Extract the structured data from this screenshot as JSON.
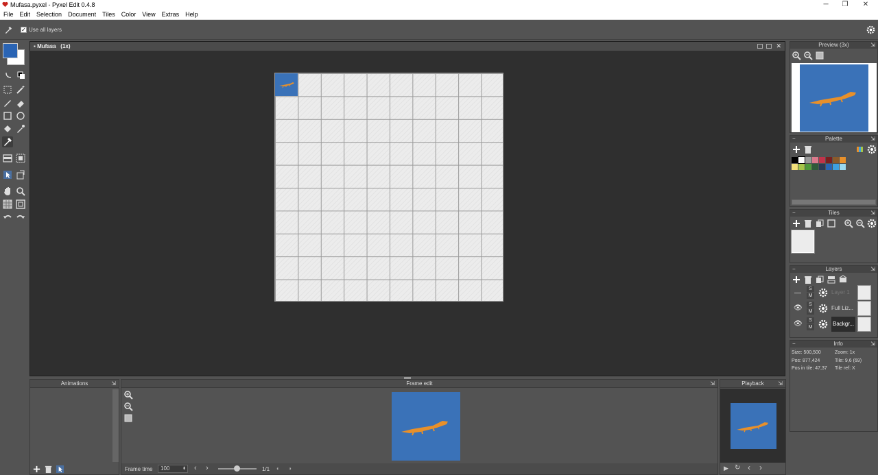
{
  "window": {
    "title": "Mufasa.pyxel - Pyxel Edit 0.4.8",
    "minimize": "─",
    "maximize": "❐",
    "close": "✕"
  },
  "menu": [
    "File",
    "Edit",
    "Selection",
    "Document",
    "Tiles",
    "Color",
    "View",
    "Extras",
    "Help"
  ],
  "tool_options": {
    "use_all_layers_label": "Use all layers",
    "use_all_layers_checked": true
  },
  "colors": {
    "primary": "#2a64b4",
    "secondary": "#ffffff",
    "background_fill": "#3a72b8",
    "lizard": "#e8902a"
  },
  "document": {
    "tab_title": "Mufasa",
    "zoom": "(1x)"
  },
  "preview": {
    "title": "Preview (3x)"
  },
  "palette": {
    "title": "Palette",
    "swatches_row1": [
      "#000000",
      "#ffffff",
      "#9b9b9b",
      "#d97a8c",
      "#c2334a",
      "#7a1f1f",
      "#8a5a2b",
      "#e8902a"
    ],
    "swatches_row2": [
      "#f3e07a",
      "#a6c64a",
      "#4f9a3b",
      "#2f5a3a",
      "#2b3a56",
      "#2a64b4",
      "#3ea0e0",
      "#9ad8f0"
    ]
  },
  "tiles": {
    "title": "Tiles"
  },
  "layers": {
    "title": "Layers",
    "items": [
      {
        "name": "Layer 1",
        "visible": false,
        "s": "S",
        "m": "M"
      },
      {
        "name": "Full Liz...",
        "visible": true,
        "s": "S",
        "m": "M"
      },
      {
        "name": "Backgr...",
        "visible": true,
        "s": "S",
        "m": "M"
      }
    ]
  },
  "info": {
    "title": "Info",
    "size": "Size: 500,500",
    "zoom": "Zoom: 1x",
    "pos": "Pos: 877,424",
    "tile": "Tile: 9,6 (69)",
    "pos_in_tile": "Pos in tile: 47,37",
    "tile_ref": "Tile ref: X"
  },
  "animations": {
    "title": "Animations"
  },
  "frame_edit": {
    "title": "Frame edit",
    "frame_time_label": "Frame time",
    "frame_time_value": "100",
    "frame_counter": "1/1"
  },
  "playback": {
    "title": "Playback"
  }
}
